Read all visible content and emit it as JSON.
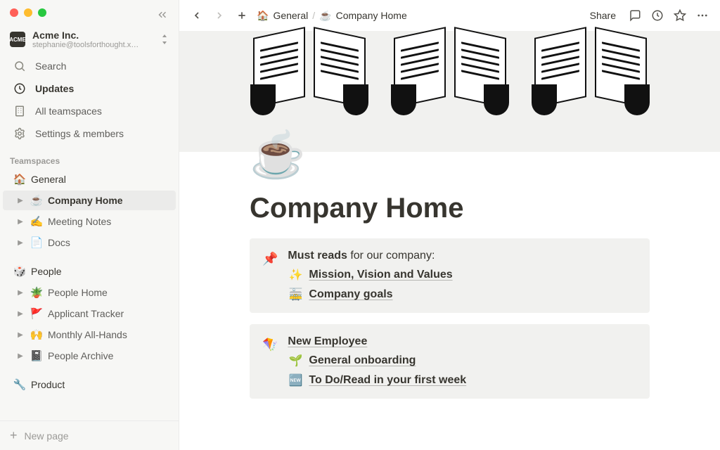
{
  "workspace": {
    "name": "Acme Inc.",
    "email": "stephanie@toolsforthought.x…",
    "icon_text": "ACME"
  },
  "sidebar": {
    "search": "Search",
    "updates": "Updates",
    "all_teamspaces": "All teamspaces",
    "settings": "Settings & members",
    "section": "Teamspaces",
    "items": {
      "general": {
        "label": "General",
        "icon": "🏠"
      },
      "company_home": {
        "label": "Company Home",
        "icon": "☕"
      },
      "meeting_notes": {
        "label": "Meeting Notes",
        "icon": "✍️"
      },
      "docs": {
        "label": "Docs",
        "icon": "📄"
      },
      "people": {
        "label": "People",
        "icon": "🎲"
      },
      "people_home": {
        "label": "People Home",
        "icon": "🪴"
      },
      "applicant_tracker": {
        "label": "Applicant Tracker",
        "icon": "🚩"
      },
      "monthly_all_hands": {
        "label": "Monthly All-Hands",
        "icon": "🙌"
      },
      "people_archive": {
        "label": "People Archive",
        "icon": "📓"
      },
      "product": {
        "label": "Product",
        "icon": "🔧"
      }
    },
    "new_page": "New page"
  },
  "breadcrumb": {
    "root": "General",
    "root_icon": "🏠",
    "sep": "/",
    "page_icon": "☕",
    "page": "Company Home"
  },
  "topbar": {
    "share": "Share"
  },
  "page": {
    "icon": "☕",
    "title": "Company Home"
  },
  "callouts": [
    {
      "icon": "📌",
      "head_bold": "Must reads",
      "head_rest": " for our company:",
      "head_is_link": false,
      "links": [
        {
          "emoji": "✨",
          "label": "Mission, Vision and Values",
          "bold": true
        },
        {
          "emoji": "🚋",
          "label": "Company goals",
          "bold": true
        }
      ]
    },
    {
      "icon": "🪁",
      "head_bold": "New Employee",
      "head_rest": "",
      "head_is_link": true,
      "links": [
        {
          "emoji": "🌱",
          "label": "General onboarding",
          "bold": true
        },
        {
          "emoji": "🆕",
          "label": "To Do/Read in your first week",
          "bold": true
        }
      ]
    }
  ]
}
